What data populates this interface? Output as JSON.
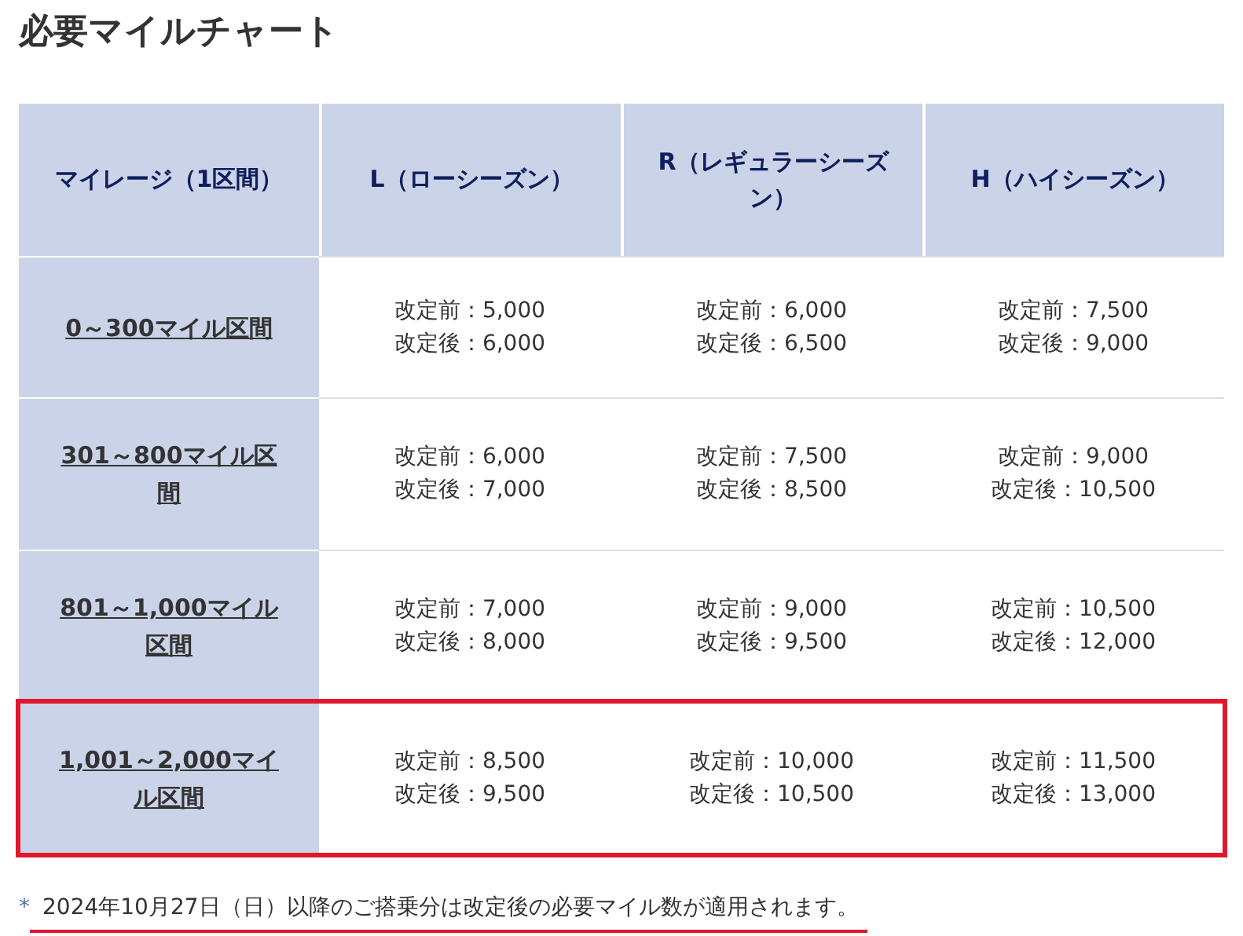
{
  "title": "必要マイルチャート",
  "table": {
    "columns": [
      "マイレージ（1区間）",
      "L（ローシーズン）",
      "R（レギュラーシーズン）",
      "H（ハイシーズン）"
    ],
    "rows": [
      {
        "highlighted": false,
        "cells": [
          [
            "0～300マイル区間"
          ],
          [
            "改定前：5,000",
            "改定後：6,000"
          ],
          [
            "改定前：6,000",
            "改定後：6,500"
          ],
          [
            "改定前：7,500",
            "改定後：9,000"
          ]
        ]
      },
      {
        "highlighted": false,
        "cells": [
          [
            "301～800マイル区間"
          ],
          [
            "改定前：6,000",
            "改定後：7,000"
          ],
          [
            "改定前：7,500",
            "改定後：8,500"
          ],
          [
            "改定前：9,000",
            "改定後：10,500"
          ]
        ]
      },
      {
        "highlighted": false,
        "cells": [
          [
            "801～1,000マイル区間"
          ],
          [
            "改定前：7,000",
            "改定後：8,000"
          ],
          [
            "改定前：9,000",
            "改定後：9,500"
          ],
          [
            "改定前：10,500",
            "改定後：12,000"
          ]
        ]
      },
      {
        "highlighted": true,
        "cells": [
          [
            "1,001～2,000マイル区間"
          ],
          [
            "改定前：8,500",
            "改定後：9,500"
          ],
          [
            "改定前：10,000",
            "改定後：10,500"
          ],
          [
            "改定前：11,500",
            "改定後：13,000"
          ]
        ]
      }
    ]
  },
  "footnote": {
    "mark": "*",
    "text": "2024年10月27日（日）以降のご搭乗分は改定後の必要マイル数が適用されます。",
    "underlined": true
  }
}
